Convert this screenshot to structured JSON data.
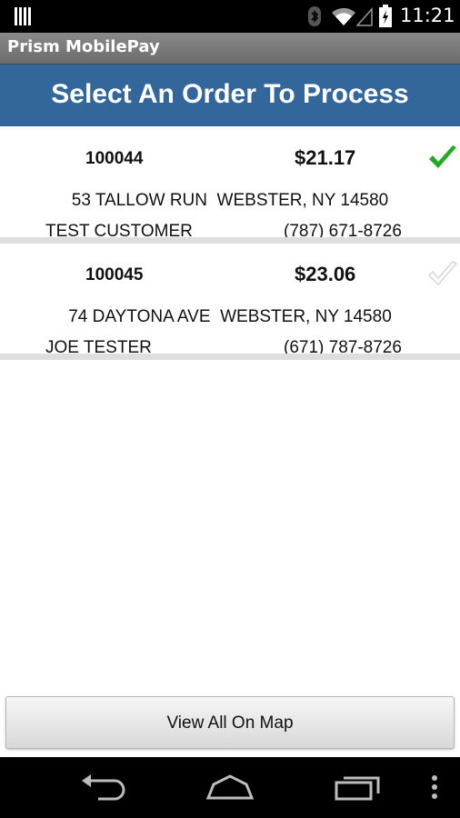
{
  "status_bar": {
    "time": "11:21",
    "icons": [
      "notification-icon",
      "bluetooth-icon",
      "wifi-icon",
      "cell-signal-icon",
      "battery-charging-icon"
    ]
  },
  "app": {
    "title": "Prism MobilePay"
  },
  "header": {
    "title": "Select An Order To Process"
  },
  "orders": [
    {
      "id": "100044",
      "amount": "$21.17",
      "address": "53 TALLOW RUN  WEBSTER, NY 14580",
      "customer": "TEST CUSTOMER",
      "phone": "(787) 671-8726",
      "checked": true,
      "check_color": "#22aa22"
    },
    {
      "id": "100045",
      "amount": "$23.06",
      "address": "74 DAYTONA AVE  WEBSTER, NY 14580",
      "customer": "JOE TESTER",
      "phone": "(671) 787-8726",
      "checked": false,
      "check_color": "#d9d9d9"
    }
  ],
  "map_button": {
    "label": "View All On Map"
  },
  "nav_bar": {
    "buttons": [
      "back-icon",
      "home-icon",
      "recent-apps-icon",
      "overflow-menu-icon"
    ]
  },
  "colors": {
    "header_blue": "#33669a",
    "action_bar_gray": "#7a7a7a",
    "check_green": "#22aa22",
    "check_gray": "#d9d9d9"
  }
}
